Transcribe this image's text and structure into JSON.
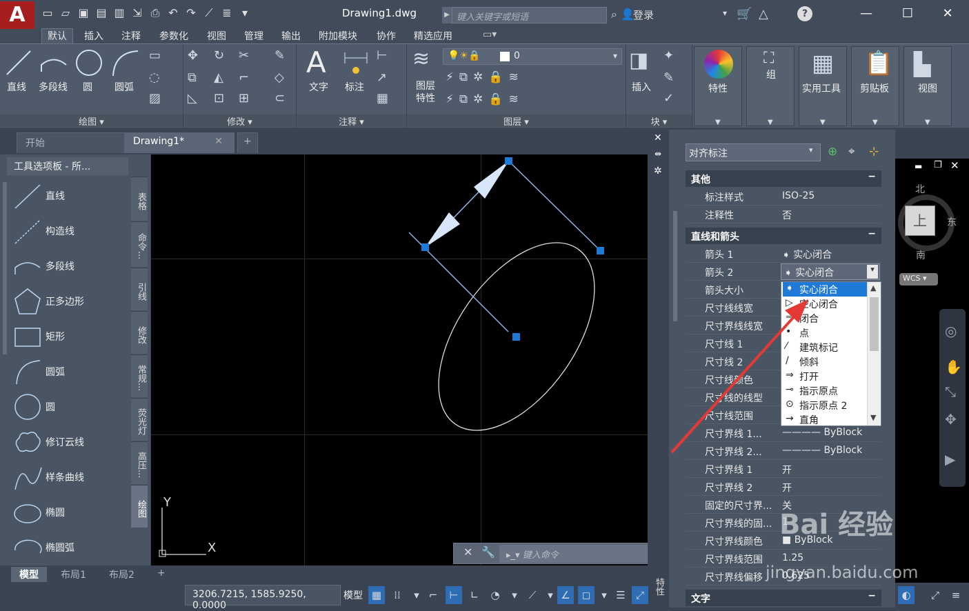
{
  "titlebar": {
    "app_icon": "A",
    "doc_title": "Drawing1.dwg",
    "search_placeholder": "键入关键字或短语",
    "login": "登录"
  },
  "menu": [
    "默认",
    "插入",
    "注释",
    "参数化",
    "视图",
    "管理",
    "输出",
    "附加模块",
    "协作",
    "精选应用"
  ],
  "ribbon": {
    "draw_tools": [
      "直线",
      "多段线",
      "圆",
      "圆弧"
    ],
    "panels": [
      "绘图",
      "修改",
      "注释",
      "图层",
      "块"
    ],
    "annotation_tools": [
      "文字",
      "标注"
    ],
    "layer_tools": [
      "图层特性"
    ],
    "layer_value": "0",
    "block_tools": [
      "插入"
    ],
    "big_tools": [
      "特性",
      "组",
      "实用工具",
      "剪贴板",
      "视图"
    ]
  },
  "tabs": [
    "开始",
    "Drawing1*"
  ],
  "tool_palette": {
    "title": "工具选项板 - 所...",
    "items": [
      "直线",
      "构造线",
      "多段线",
      "正多边形",
      "矩形",
      "圆弧",
      "圆",
      "修订云线",
      "样条曲线",
      "椭圆",
      "椭圆弧"
    ],
    "side_tabs": [
      "表格",
      "命令...",
      "引线",
      "修改",
      "常规...",
      "荧光灯",
      "高压...",
      "绘图"
    ]
  },
  "layout_tabs": [
    "模型",
    "布局1",
    "布局2"
  ],
  "command": {
    "placeholder": "键入命令"
  },
  "status": {
    "coords": "3206.7215, 1585.9250, 0.0000",
    "model": "模型"
  },
  "viewcube": {
    "north": "北",
    "south": "南",
    "east": "东",
    "top": "上",
    "wcs": "WCS"
  },
  "axis": {
    "x": "X",
    "y": "Y"
  },
  "properties": {
    "dim_type": "对齐标注",
    "side_label": "特性",
    "sections": {
      "misc": "其他",
      "lines_arrows": "直线和箭头",
      "text": "文字"
    },
    "misc_rows": [
      {
        "name": "标注样式",
        "value": "ISO-25"
      },
      {
        "name": "注释性",
        "value": "否"
      }
    ],
    "line_rows": [
      {
        "name": "箭头 1",
        "value": "实心闭合"
      },
      {
        "name": "箭头 2",
        "value": "实心闭合"
      },
      {
        "name": "箭头大小",
        "value": ""
      },
      {
        "name": "尺寸线线宽",
        "value": ""
      },
      {
        "name": "尺寸界线线宽",
        "value": ""
      },
      {
        "name": "尺寸线 1",
        "value": ""
      },
      {
        "name": "尺寸线 2",
        "value": ""
      },
      {
        "name": "尺寸线颜色",
        "value": ""
      },
      {
        "name": "尺寸线的线型",
        "value": ""
      },
      {
        "name": "尺寸线范围",
        "value": ""
      },
      {
        "name": "尺寸界线 1...",
        "value": "ByBlock"
      },
      {
        "name": "尺寸界线 2...",
        "value": "ByBlock"
      },
      {
        "name": "尺寸界线 1",
        "value": "开"
      },
      {
        "name": "尺寸界线 2",
        "value": "开"
      },
      {
        "name": "固定的尺寸界...",
        "value": "关"
      },
      {
        "name": "尺寸界线的固...",
        "value": "1"
      },
      {
        "name": "尺寸界线颜色",
        "value": "ByBlock"
      },
      {
        "name": "尺寸界线范围",
        "value": "1.25"
      },
      {
        "name": "尺寸界线偏移",
        "value": "0.625"
      }
    ],
    "arrow_options": [
      "实心闭合",
      "空心闭合",
      "闭合",
      "点",
      "建筑标记",
      "倾斜",
      "打开",
      "指示原点",
      "指示原点 2",
      "直角"
    ]
  },
  "watermark": {
    "brand": "Bai 经验",
    "url": "jingyan.baidu.com"
  },
  "colors": {
    "accent": "#1e7ad6",
    "grip": "#1e7ad6",
    "red_arrow": "#e53935"
  }
}
